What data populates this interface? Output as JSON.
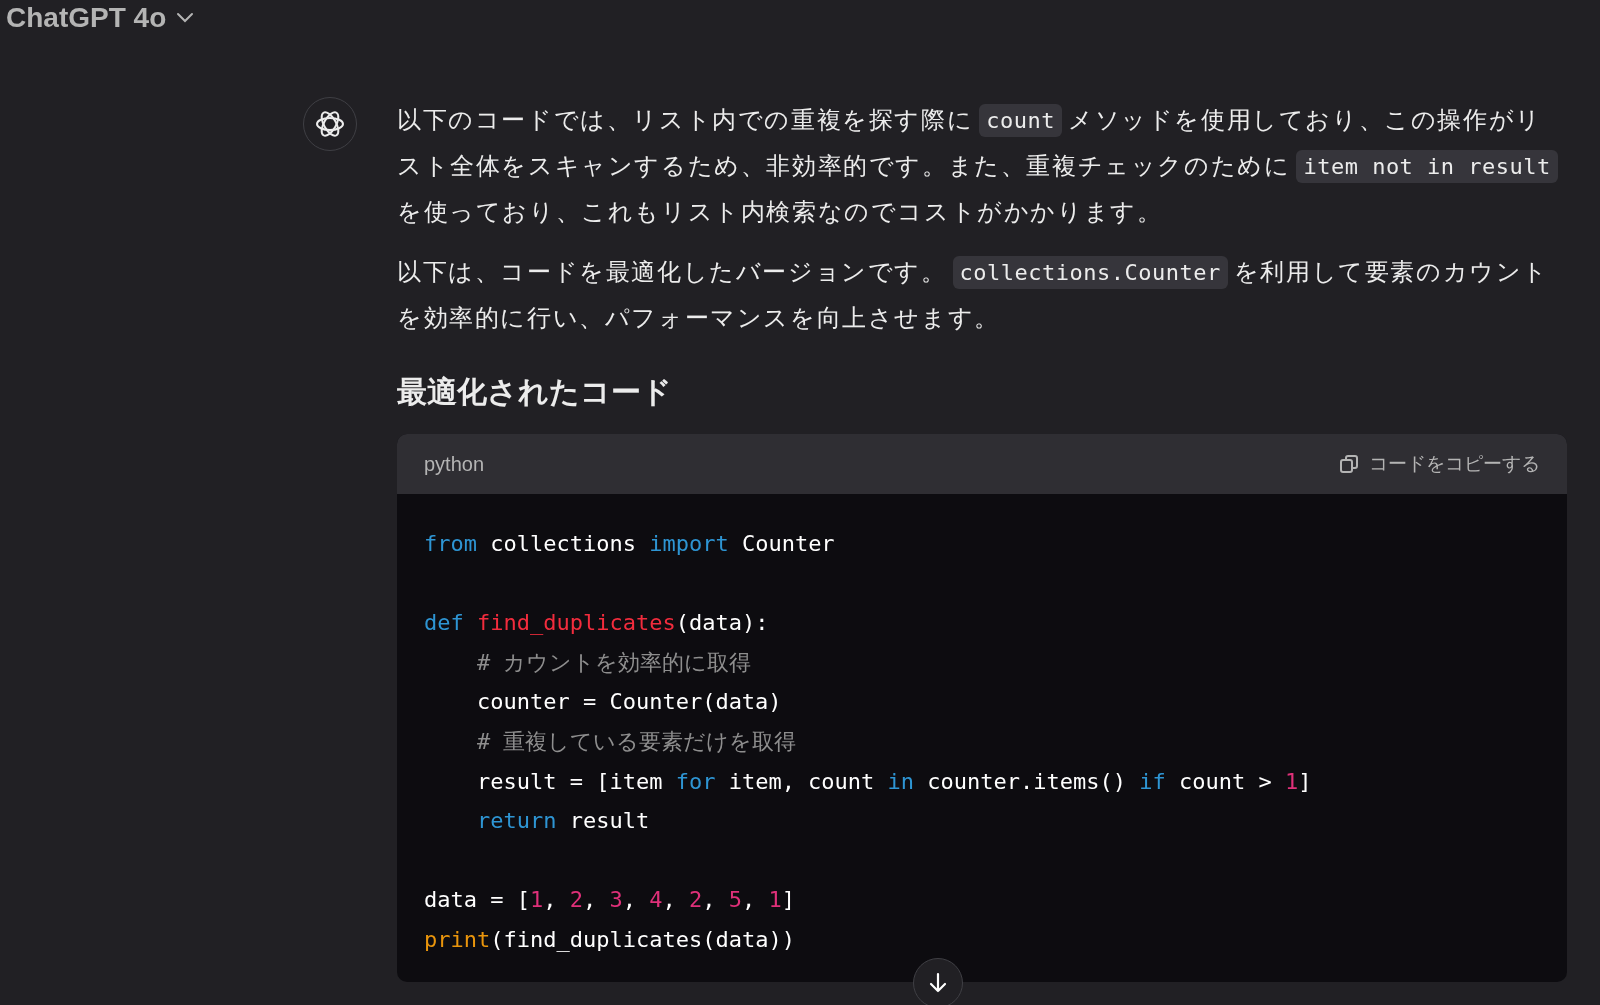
{
  "header": {
    "title": "ChatGPT 4o"
  },
  "message": {
    "paragraphs": [
      [
        {
          "kind": "text",
          "text": "以下のコードでは、リスト内での重複を探す際に"
        },
        {
          "kind": "code",
          "text": "count"
        },
        {
          "kind": "text",
          "text": "メソッドを使用しており、この操作がリスト全体をスキャンするため、非効率的です。また、重複チェックのために"
        },
        {
          "kind": "code",
          "text": "item not in result"
        },
        {
          "kind": "text",
          "text": "を使っており、これもリスト内検索なのでコストがかかります。"
        }
      ],
      [
        {
          "kind": "text",
          "text": "以下は、コードを最適化したバージョンです。"
        },
        {
          "kind": "code",
          "text": "collections.Counter"
        },
        {
          "kind": "text",
          "text": "を利用して要素のカウントを効率的に行い、パフォーマンスを向上させます。"
        }
      ]
    ],
    "heading": "最適化されたコード",
    "code_block": {
      "language": "python",
      "copy_label": "コードをコピーする",
      "lines": [
        {
          "kind": "code",
          "tokens": [
            {
              "kind": "keyword",
              "text": "from"
            },
            {
              "kind": "plain",
              "text": " collections "
            },
            {
              "kind": "keyword",
              "text": "import"
            },
            {
              "kind": "plain",
              "text": " Counter"
            }
          ]
        },
        {
          "kind": "blank"
        },
        {
          "kind": "code",
          "tokens": [
            {
              "kind": "keyword",
              "text": "def "
            },
            {
              "kind": "function",
              "text": "find_duplicates"
            },
            {
              "kind": "plain",
              "text": "(data):"
            }
          ]
        },
        {
          "kind": "code",
          "indented": true,
          "tokens": [
            {
              "kind": "comment",
              "text": "# カウントを効率的に取得"
            }
          ]
        },
        {
          "kind": "code",
          "indented": true,
          "tokens": [
            {
              "kind": "plain",
              "text": "counter = Counter(data)"
            }
          ]
        },
        {
          "kind": "code",
          "indented": true,
          "tokens": [
            {
              "kind": "comment",
              "text": "# 重複している要素だけを取得"
            }
          ]
        },
        {
          "kind": "code",
          "indented": true,
          "tokens": [
            {
              "kind": "plain",
              "text": "result = [item "
            },
            {
              "kind": "keyword",
              "text": "for"
            },
            {
              "kind": "plain",
              "text": " item, count "
            },
            {
              "kind": "keyword",
              "text": "in"
            },
            {
              "kind": "plain",
              "text": " counter.items() "
            },
            {
              "kind": "keyword",
              "text": "if"
            },
            {
              "kind": "plain",
              "text": " count > "
            },
            {
              "kind": "number",
              "text": "1"
            },
            {
              "kind": "plain",
              "text": "]"
            }
          ]
        },
        {
          "kind": "code",
          "indented": true,
          "tokens": [
            {
              "kind": "keyword",
              "text": "return"
            },
            {
              "kind": "plain",
              "text": " result"
            }
          ]
        },
        {
          "kind": "blank"
        },
        {
          "kind": "code",
          "tokens": [
            {
              "kind": "plain",
              "text": "data = ["
            },
            {
              "kind": "number",
              "text": "1"
            },
            {
              "kind": "plain",
              "text": ", "
            },
            {
              "kind": "number",
              "text": "2"
            },
            {
              "kind": "plain",
              "text": ", "
            },
            {
              "kind": "number",
              "text": "3"
            },
            {
              "kind": "plain",
              "text": ", "
            },
            {
              "kind": "number",
              "text": "4"
            },
            {
              "kind": "plain",
              "text": ", "
            },
            {
              "kind": "number",
              "text": "2"
            },
            {
              "kind": "plain",
              "text": ", "
            },
            {
              "kind": "number",
              "text": "5"
            },
            {
              "kind": "plain",
              "text": ", "
            },
            {
              "kind": "number",
              "text": "1"
            },
            {
              "kind": "plain",
              "text": "]"
            }
          ]
        },
        {
          "kind": "code",
          "tokens": [
            {
              "kind": "builtin",
              "text": "print"
            },
            {
              "kind": "plain",
              "text": "(find_duplicates(data))"
            }
          ]
        }
      ]
    }
  }
}
